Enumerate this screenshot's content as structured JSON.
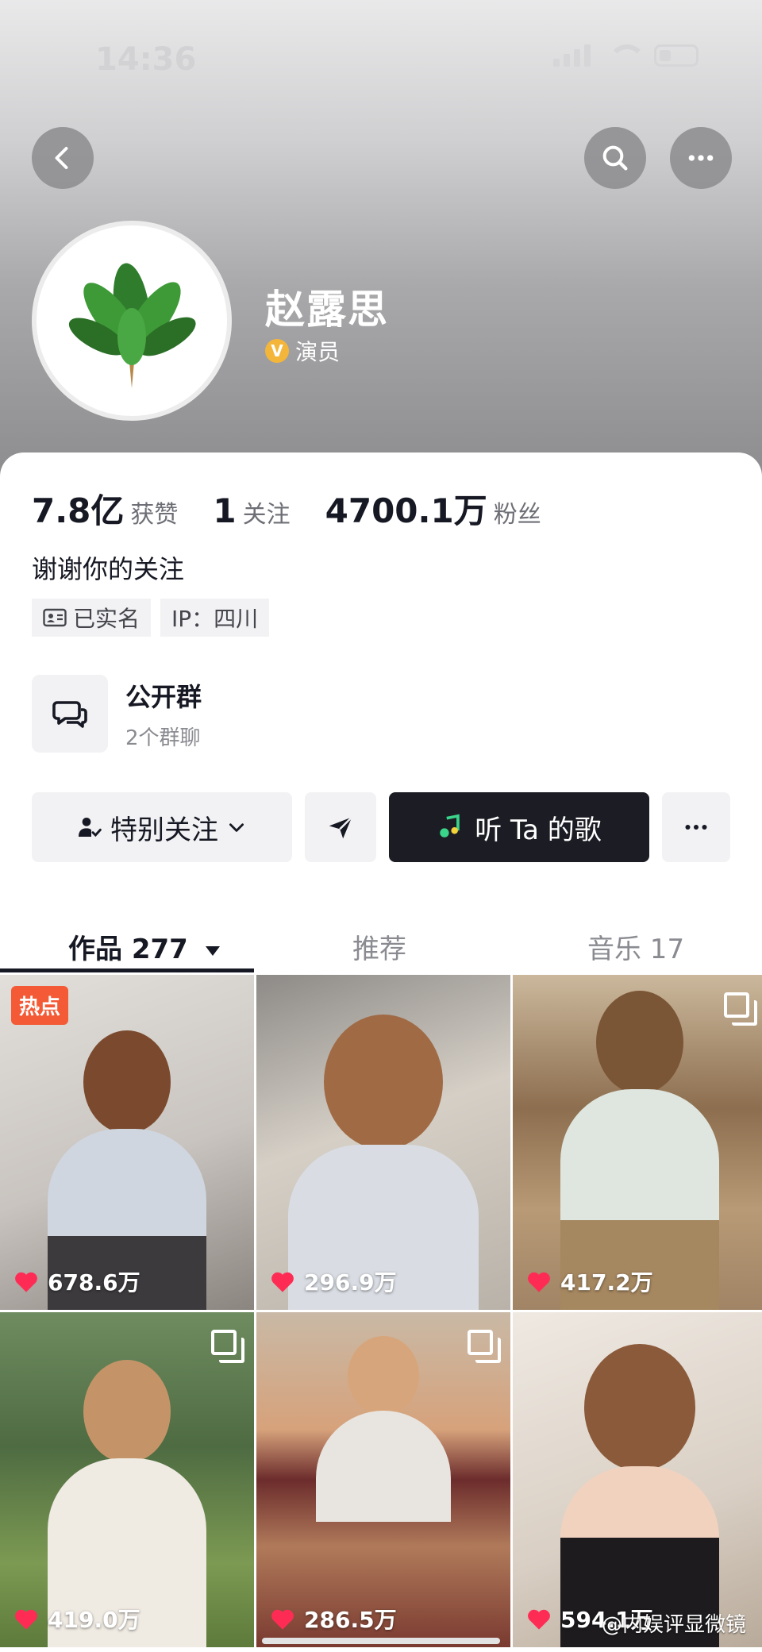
{
  "status": {
    "time": "14:36"
  },
  "profile": {
    "name": "赵露思",
    "verify_label": "演员"
  },
  "stats": [
    {
      "num": "7.8亿",
      "label": "获赞"
    },
    {
      "num": "1",
      "label": "关注"
    },
    {
      "num": "4700.1万",
      "label": "粉丝"
    }
  ],
  "bio": "谢谢你的关注",
  "tags": {
    "realname": "已实名",
    "ip": "IP：四川"
  },
  "group": {
    "title": "公开群",
    "subtitle": "2个群聊"
  },
  "actions": {
    "follow": "特别关注",
    "song": "听 Ta 的歌"
  },
  "tabs": {
    "works": "作品 277",
    "recommend": "推荐",
    "music": "音乐 17"
  },
  "videos": [
    {
      "likes": "678.6万",
      "badge": "热点"
    },
    {
      "likes": "296.9万"
    },
    {
      "likes": "417.2万"
    },
    {
      "likes": "419.0万"
    },
    {
      "likes": "286.5万"
    },
    {
      "likes": "594.1万"
    }
  ],
  "watermark": "@内娱评显微镜",
  "colors": {
    "accent_hot": "#f45a36",
    "like_heart": "#fe2c55",
    "dark_button": "#1c1d24",
    "verify": "#f4b63a"
  }
}
